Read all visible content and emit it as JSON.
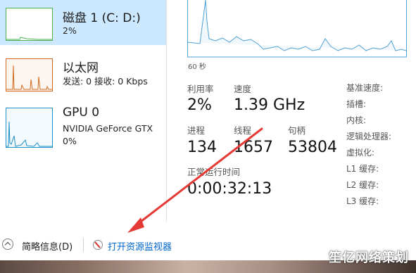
{
  "sidebar": {
    "disk": {
      "title": "磁盘 1 (C: D:)",
      "detail": "2%"
    },
    "ethernet": {
      "title": "以太网",
      "detail": "发送: 0 接收: 0 Kbps"
    },
    "gpu": {
      "title": "GPU 0",
      "model": "NVIDIA GeForce GTX",
      "detail": "0%"
    }
  },
  "graph": {
    "time_label": "60 秒",
    "line_color": "#4ea1d3"
  },
  "stats": {
    "utilization_label": "利用率",
    "utilization_value": "2%",
    "speed_label": "速度",
    "speed_value": "1.39 GHz",
    "processes_label": "进程",
    "processes_value": "134",
    "threads_label": "线程",
    "threads_value": "1657",
    "handles_label": "句柄",
    "handles_value": "53804",
    "uptime_label": "正常运行时间",
    "uptime_value": "0:00:32:13"
  },
  "specs": {
    "base_speed": "基准速度:",
    "sockets": "插槽:",
    "cores": "内核:",
    "logical_processors": "逻辑处理器:",
    "virtualization": "虚拟化:",
    "l1": "L1 缓存:",
    "l2": "L2 缓存:",
    "l3": "L3 缓存:"
  },
  "footer": {
    "fewer_details": "简略信息(D)",
    "open_resource_monitor": "打开资源监视器"
  },
  "watermark": "笙亿网络策划",
  "colors": {
    "selected_bg": "#cce8ff",
    "disk_line": "#4caf50",
    "ethernet_line": "#d2691e",
    "gpu_line": "#1e90c8",
    "arrow": "#e53935",
    "link": "#0066cc"
  }
}
